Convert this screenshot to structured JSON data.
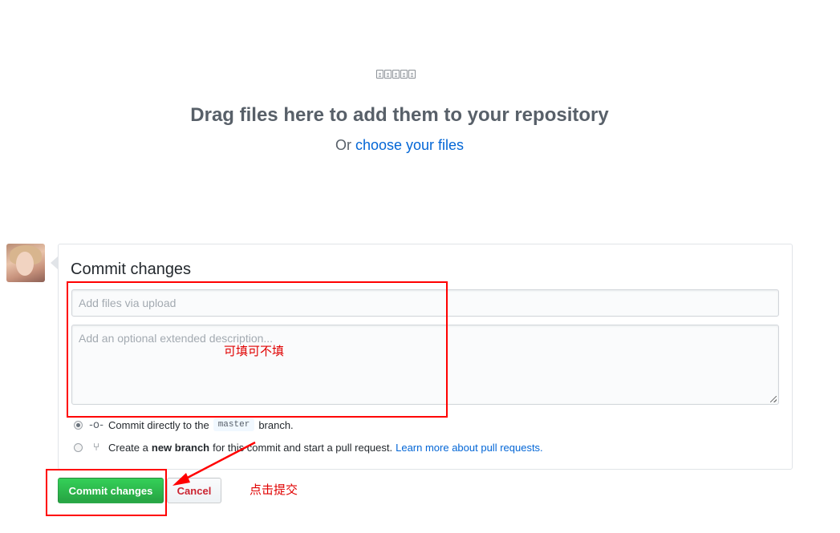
{
  "dropzone": {
    "file_icons": [
      "file-icon",
      "file-chart-icon",
      "file-code-icon",
      "file-text-icon",
      "file-pdf-icon"
    ],
    "title": "Drag files here to add them to your repository",
    "or_text": "Or",
    "choose_link": "choose your files"
  },
  "commit": {
    "title": "Commit changes",
    "summary_placeholder": "Add files via upload",
    "description_placeholder": "Add an optional extended description...",
    "option_direct": {
      "text_before": "Commit directly to the",
      "branch": "master",
      "text_after": "branch.",
      "checked": true
    },
    "option_new": {
      "text_before": "Create a",
      "bold": "new branch",
      "text_after": "for this commit and start a pull request.",
      "link": "Learn more about pull requests.",
      "checked": false
    },
    "commit_button": "Commit changes",
    "cancel_button": "Cancel"
  },
  "annotations": {
    "optional_note": "可填可不填",
    "click_note": "点击提交",
    "color": "#ff0000"
  },
  "colors": {
    "link": "#0366d6",
    "commit_button": "#28a745",
    "cancel_text": "#cb2431"
  }
}
